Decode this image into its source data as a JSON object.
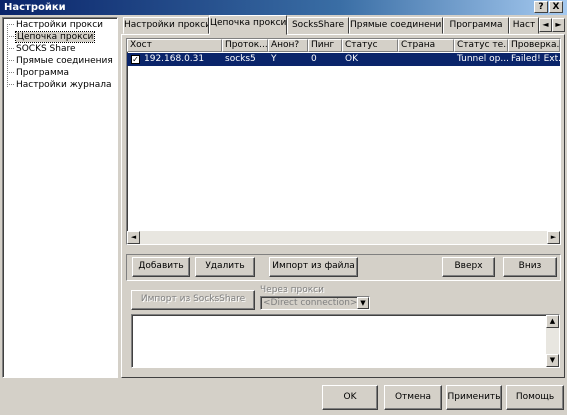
{
  "window": {
    "title": "Настройки",
    "help_btn": "?",
    "close_btn": "X"
  },
  "tree": {
    "items": [
      {
        "label": "Настройки прокси",
        "selected": false
      },
      {
        "label": "Цепочка прокси",
        "selected": true
      },
      {
        "label": "SOCKS Share",
        "selected": false
      },
      {
        "label": "Прямые соединения",
        "selected": false
      },
      {
        "label": "Программа",
        "selected": false
      },
      {
        "label": "Настройки журнала",
        "selected": false
      }
    ]
  },
  "tabs": [
    {
      "label": "Настройки прокси",
      "active": false
    },
    {
      "label": "Цепочка прокси",
      "active": true
    },
    {
      "label": "SocksShare",
      "active": false
    },
    {
      "label": "Прямые соединения",
      "active": false
    },
    {
      "label": "Программа",
      "active": false
    },
    {
      "label": "Наст",
      "active": false
    }
  ],
  "tab_scroll": {
    "left": "◄",
    "right": "►"
  },
  "grid": {
    "columns": [
      "Хост",
      "Проток...",
      "Анон?",
      "Пинг",
      "Статус",
      "Страна",
      "Статус те...",
      "Проверка..."
    ],
    "rows": [
      {
        "checked": true,
        "check_glyph": "✓",
        "cells": [
          "192.168.0.31",
          "socks5",
          "Y",
          "0",
          "OK",
          "",
          "Tunnel op...",
          "Failed! Ext..."
        ]
      }
    ]
  },
  "buttons": {
    "add": "Добавить",
    "remove": "Удалить",
    "import_file": "Импорт из файла",
    "up": "Вверх",
    "down": "Вниз",
    "import_socks": "Импорт из SocksShare"
  },
  "via_proxy": {
    "label": "Через прокси",
    "value": "<Direct connection>"
  },
  "footer": {
    "ok": "OK",
    "cancel": "Отмена",
    "apply": "Применить",
    "help": "Помощь"
  },
  "scroll_glyphs": {
    "left": "◄",
    "right": "►",
    "up": "▲",
    "down": "▼"
  }
}
